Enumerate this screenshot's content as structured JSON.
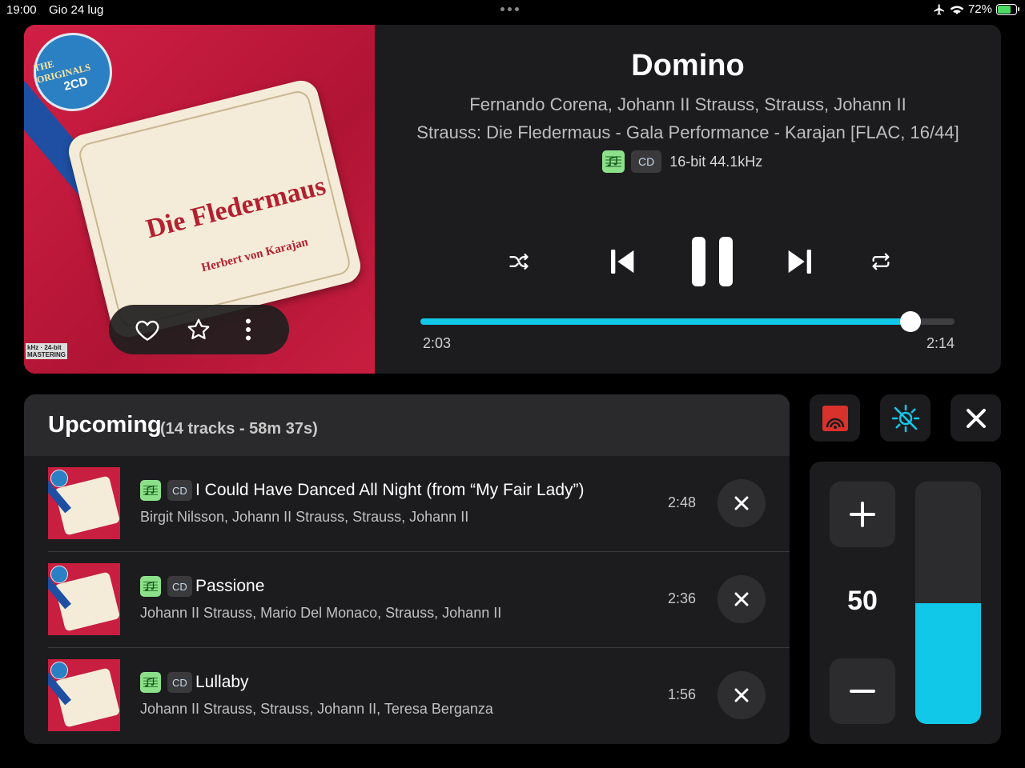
{
  "status_bar": {
    "time": "19:00",
    "date": "Gio 24 lug",
    "battery": "72%",
    "battery_level": 0.72
  },
  "now_playing": {
    "title": "Domino",
    "artists": "Fernando Corena, Johann II Strauss, Strauss, Johann II",
    "album": "Strauss: Die Fledermaus - Gala Performance - Karajan [FLAC, 16/44]",
    "source_tag": "CD",
    "quality": "16-bit 44.1kHz",
    "elapsed": "2:03",
    "total": "2:14",
    "progress": 0.918,
    "cover": {
      "badge_line1": "THE ORIGINALS",
      "badge_line2": "2CD",
      "label_title": "Die Fledermaus",
      "label_conductor": "Herbert von Karajan",
      "mastering": "kHz · 24-bit\nMASTERING"
    },
    "actions": [
      "heart-icon",
      "star-icon",
      "more-icon"
    ],
    "controls": [
      "shuffle-icon",
      "previous-icon",
      "pause-icon",
      "next-icon",
      "repeat-icon"
    ]
  },
  "upcoming": {
    "title": "Upcoming",
    "summary": "(14 tracks - 58m 37s)",
    "tracks": [
      {
        "tag": "CD",
        "title": "I Could Have Danced All Night (from “My Fair Lady”)",
        "artists": "Birgit Nilsson, Johann II Strauss, Strauss, Johann II",
        "duration": "2:48"
      },
      {
        "tag": "CD",
        "title": "Passione",
        "artists": "Johann II Strauss, Mario Del Monaco, Strauss, Johann II",
        "duration": "2:36"
      },
      {
        "tag": "CD",
        "title": "Lullaby",
        "artists": "Johann II Strauss, Strauss, Johann II, Teresa Berganza",
        "duration": "1:56"
      }
    ]
  },
  "volume": {
    "value": "50",
    "level": 0.5
  },
  "colors": {
    "accent": "#12c8e8",
    "quality_badge": "#8de08a",
    "output_red": "#d9312b"
  }
}
